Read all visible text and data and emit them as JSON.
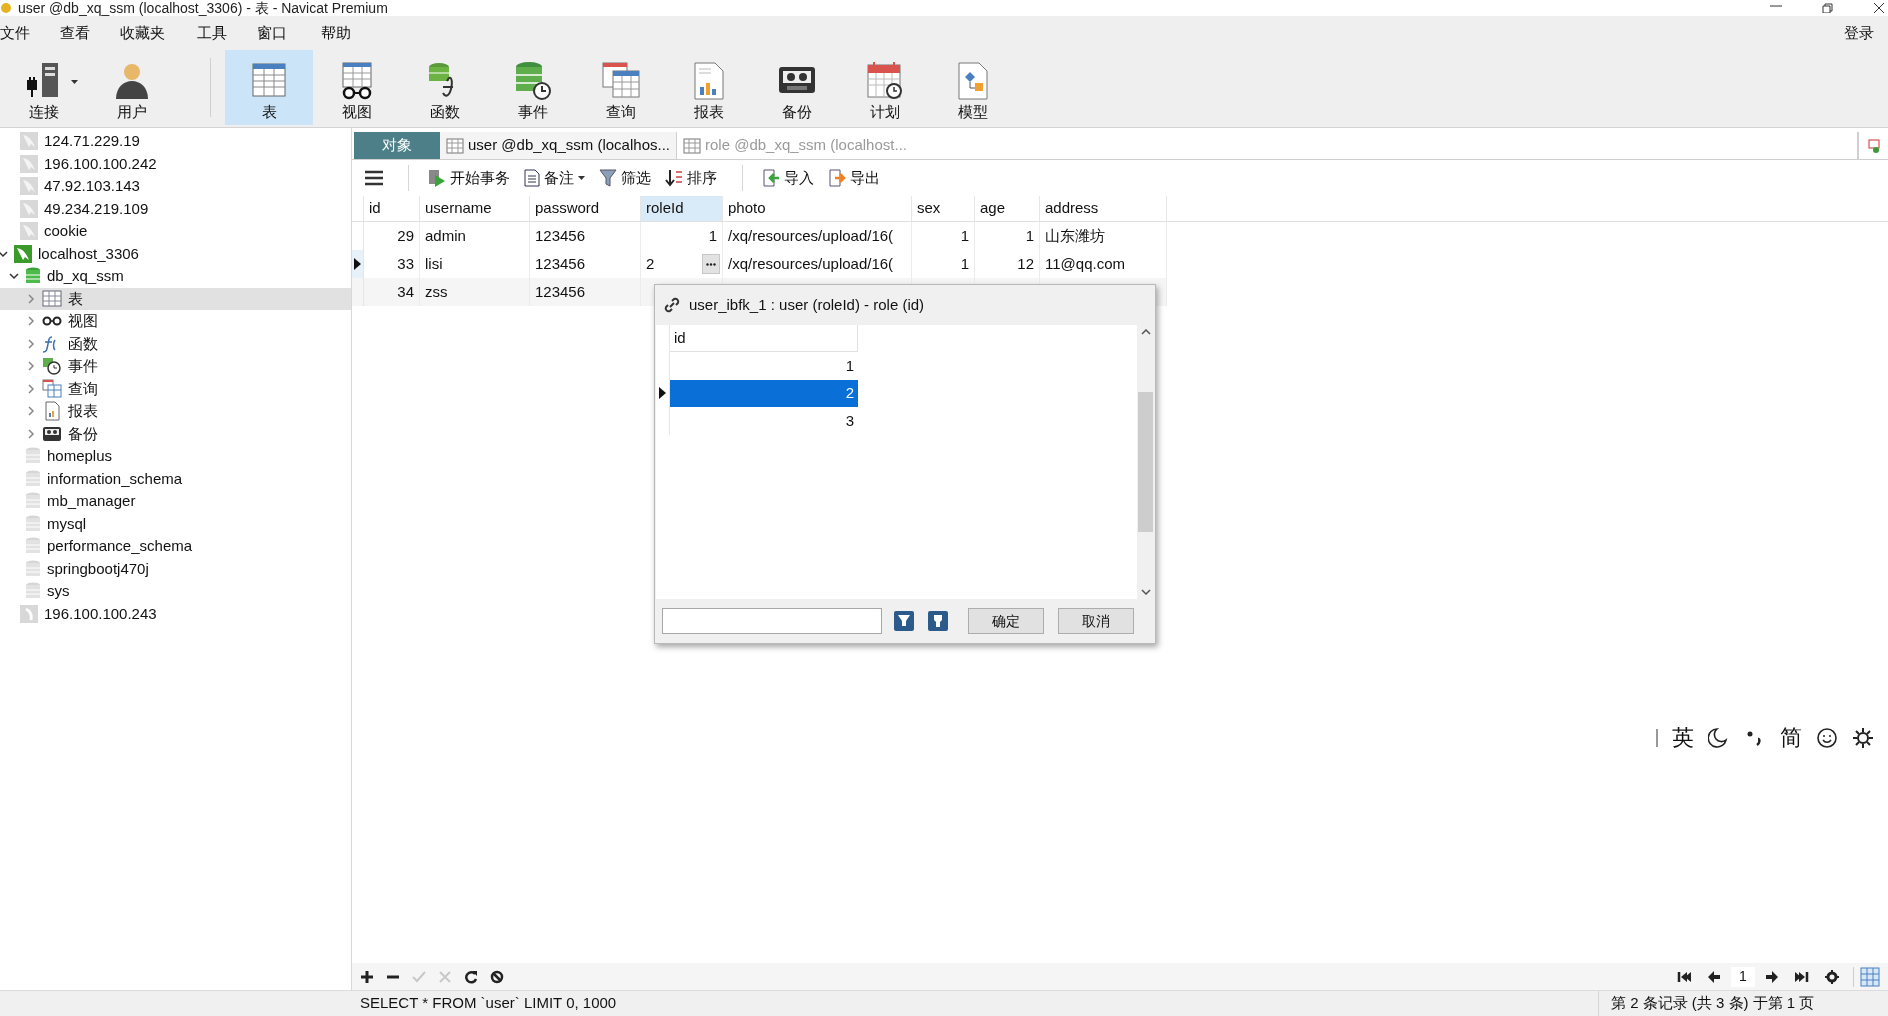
{
  "window": {
    "title": "user @db_xq_ssm (localhost_3306) - 表 - Navicat Premium"
  },
  "menu": [
    "文件",
    "查看",
    "收藏夹",
    "工具",
    "窗口",
    "帮助"
  ],
  "login": "登录",
  "toolbar": [
    {
      "kind": "connect",
      "label": "连接",
      "selected": false
    },
    {
      "kind": "user",
      "label": "用户",
      "selected": false
    },
    {
      "kind": "table",
      "label": "表",
      "selected": true
    },
    {
      "kind": "view",
      "label": "视图",
      "selected": false
    },
    {
      "kind": "function",
      "label": "函数",
      "selected": false
    },
    {
      "kind": "event",
      "label": "事件",
      "selected": false
    },
    {
      "kind": "query",
      "label": "查询",
      "selected": false
    },
    {
      "kind": "report",
      "label": "报表",
      "selected": false
    },
    {
      "kind": "backup",
      "label": "备份",
      "selected": false
    },
    {
      "kind": "schedule",
      "label": "计划",
      "selected": false
    },
    {
      "kind": "model",
      "label": "模型",
      "selected": false
    }
  ],
  "sidebar": {
    "items": [
      {
        "kind": "server",
        "label": "124.71.229.19",
        "active": false,
        "selected": false
      },
      {
        "kind": "server",
        "label": "196.100.100.242",
        "active": false,
        "selected": false
      },
      {
        "kind": "server",
        "label": "47.92.103.143",
        "active": false,
        "selected": false
      },
      {
        "kind": "server",
        "label": "49.234.219.109",
        "active": false,
        "selected": false
      },
      {
        "kind": "server",
        "label": "cookie",
        "active": false,
        "selected": false
      },
      {
        "kind": "server",
        "label": "localhost_3306",
        "active": true,
        "expanded": true,
        "selected": false,
        "children": [
          {
            "kind": "database",
            "label": "db_xq_ssm",
            "active": true,
            "expanded": true,
            "selected": false,
            "children": [
              {
                "kind": "tables",
                "label": "表",
                "expanded": false,
                "selected": true
              },
              {
                "kind": "views",
                "label": "视图",
                "expanded": false,
                "selected": false
              },
              {
                "kind": "functions",
                "label": "函数",
                "expanded": false,
                "selected": false
              },
              {
                "kind": "events",
                "label": "事件",
                "expanded": false,
                "selected": false
              },
              {
                "kind": "queries",
                "label": "查询",
                "expanded": false,
                "selected": false
              },
              {
                "kind": "reports",
                "label": "报表",
                "expanded": false,
                "selected": false
              },
              {
                "kind": "backups",
                "label": "备份",
                "expanded": false,
                "selected": false
              }
            ]
          },
          {
            "kind": "database",
            "label": "homeplus",
            "active": false,
            "selected": false
          },
          {
            "kind": "database",
            "label": "information_schema",
            "active": false,
            "selected": false
          },
          {
            "kind": "database",
            "label": "mb_manager",
            "active": false,
            "selected": false
          },
          {
            "kind": "database",
            "label": "mysql",
            "active": false,
            "selected": false
          },
          {
            "kind": "database",
            "label": "performance_schema",
            "active": false,
            "selected": false
          },
          {
            "kind": "database",
            "label": "springbootj470j",
            "active": false,
            "selected": false
          },
          {
            "kind": "database",
            "label": "sys",
            "active": false,
            "selected": false
          }
        ]
      },
      {
        "kind": "server_other",
        "label": "196.100.100.243",
        "selected": false
      }
    ]
  },
  "tabs": [
    {
      "kind": "objects",
      "label": "对象",
      "selected": false
    },
    {
      "kind": "table",
      "label": "user @db_xq_ssm (localhos...",
      "selected": true
    },
    {
      "kind": "table",
      "label": "role @db_xq_ssm (localhost...",
      "selected": false
    }
  ],
  "data_toolbar": [
    {
      "kind": "menu"
    },
    {
      "kind": "begin",
      "label": "开始事务"
    },
    {
      "kind": "note",
      "label": "备注"
    },
    {
      "kind": "filter",
      "label": "筛选"
    },
    {
      "kind": "sort",
      "label": "排序"
    },
    {
      "kind": "import",
      "label": "导入"
    },
    {
      "kind": "export",
      "label": "导出"
    }
  ],
  "table": {
    "columns": [
      {
        "label": "id",
        "kind": "number",
        "selected": false
      },
      {
        "label": "username",
        "kind": "text",
        "selected": false
      },
      {
        "label": "password",
        "kind": "text",
        "selected": false
      },
      {
        "label": "roleId",
        "kind": "number",
        "selected": true
      },
      {
        "label": "photo",
        "kind": "text",
        "selected": false
      },
      {
        "label": "sex",
        "kind": "number",
        "selected": false
      },
      {
        "label": "age",
        "kind": "number",
        "selected": false
      },
      {
        "label": "address",
        "kind": "text",
        "selected": false
      }
    ],
    "rows": [
      {
        "selected": false,
        "editing": false,
        "cells": [
          "29",
          "admin",
          "123456",
          "1",
          "/xq/resources/upload/16(",
          "1",
          "1",
          "山东潍坊"
        ]
      },
      {
        "selected": true,
        "editing": true,
        "cells": [
          "33",
          "lisi",
          "123456",
          "2",
          "/xq/resources/upload/16(",
          "1",
          "12",
          "11@qq.com"
        ]
      },
      {
        "selected": false,
        "editing": false,
        "cells": [
          "34",
          "zss",
          "123456"
        ]
      }
    ]
  },
  "lookup": {
    "title": "user_ibfk_1 : user (roleId) - role (id)",
    "column": "id",
    "rows": [
      {
        "value": "1",
        "selected": false
      },
      {
        "value": "2",
        "selected": true
      },
      {
        "value": "3",
        "selected": false
      }
    ],
    "buttons": [
      "确定",
      "取消"
    ]
  },
  "pager": {
    "page": "1"
  },
  "status_bar": {
    "sql": "SELECT * FROM `user` LIMIT 0, 1000",
    "record": "第 2 条记录 (共 3 条) 于第 1 页"
  },
  "ime": [
    {
      "kind": "text",
      "label": "英"
    },
    {
      "kind": "moon"
    },
    {
      "kind": "punct"
    },
    {
      "kind": "text",
      "label": "简"
    },
    {
      "kind": "smile"
    },
    {
      "kind": "gear"
    }
  ]
}
